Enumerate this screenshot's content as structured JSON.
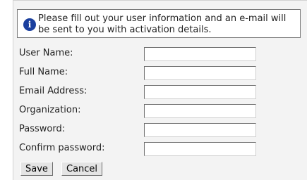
{
  "info": {
    "icon": "info-icon",
    "icon_glyph": "i",
    "message": "Please fill out your user information and an e-mail will be sent to you with activation details."
  },
  "form": {
    "fields": [
      {
        "label": "User Name:",
        "value": ""
      },
      {
        "label": "Full Name:",
        "value": ""
      },
      {
        "label": "Email Address:",
        "value": ""
      },
      {
        "label": "Organization:",
        "value": ""
      },
      {
        "label": "Password:",
        "value": ""
      },
      {
        "label": "Confirm password:",
        "value": ""
      }
    ],
    "save_label": "Save",
    "cancel_label": "Cancel"
  },
  "colors": {
    "panel_bg": "#f3f3f3",
    "info_icon": "#1a3f9e"
  }
}
